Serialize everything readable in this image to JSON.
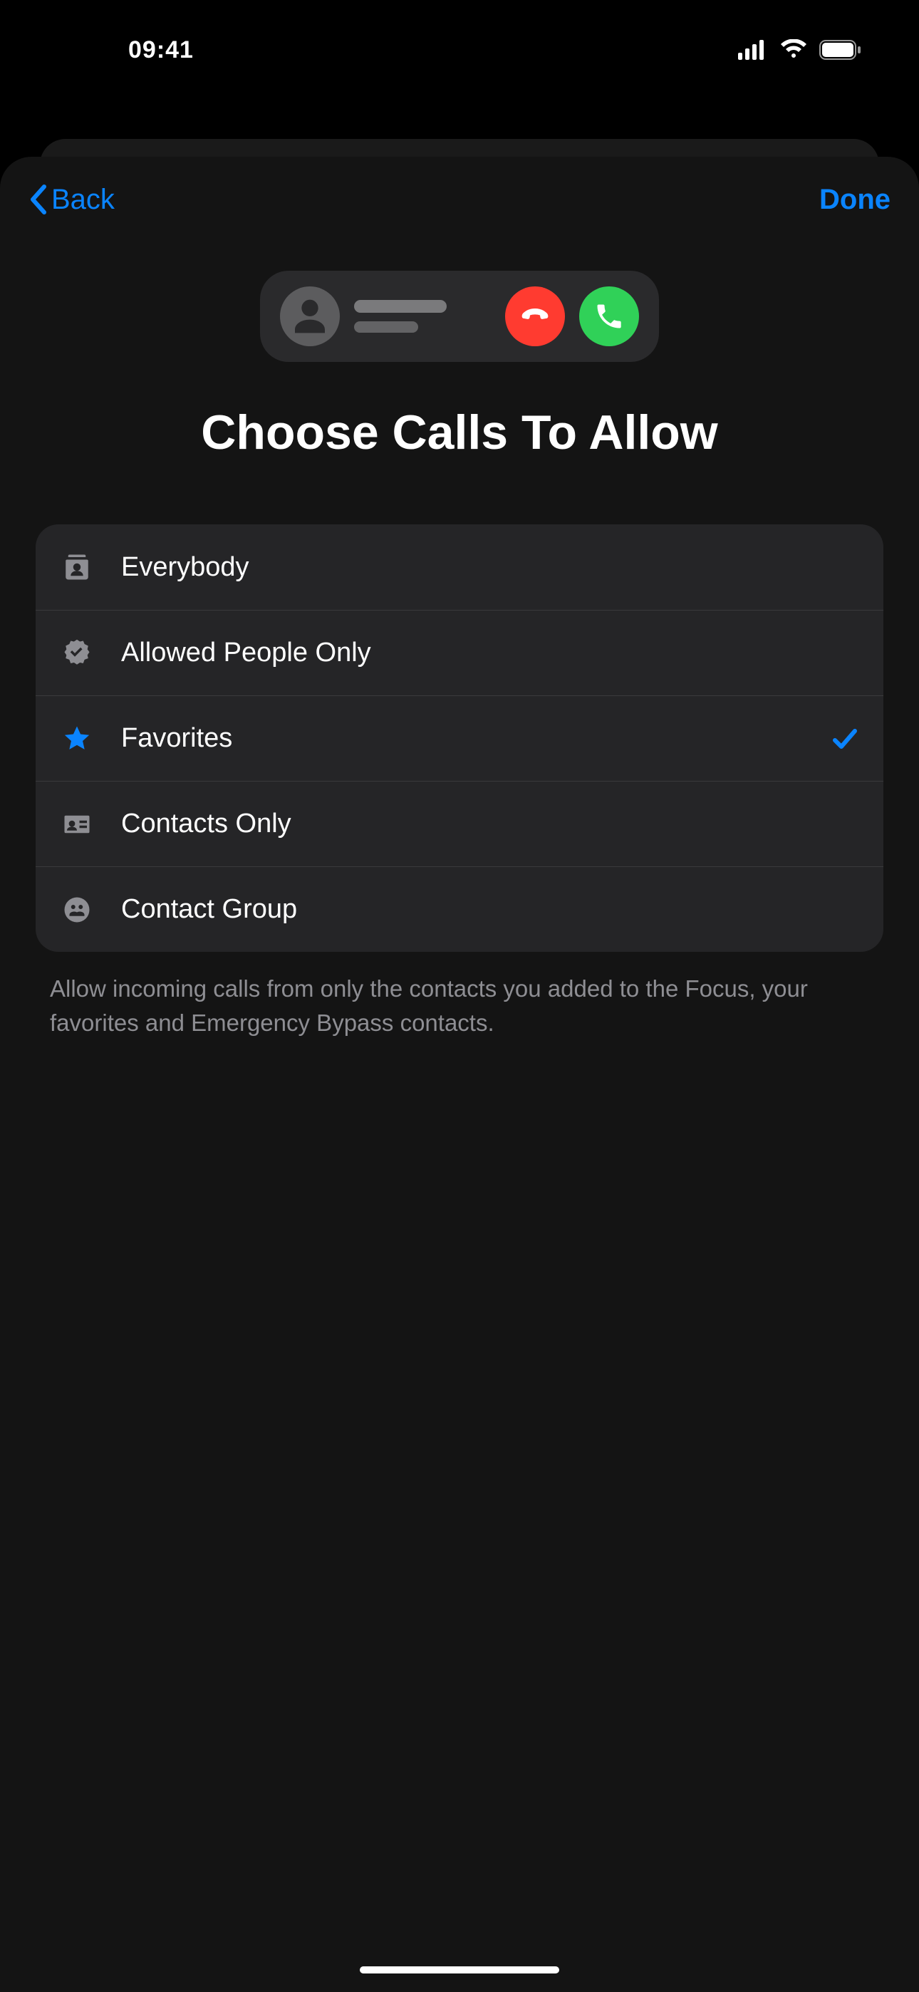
{
  "status_bar": {
    "time": "09:41"
  },
  "nav": {
    "back_label": "Back",
    "done_label": "Done"
  },
  "hero": {
    "title": "Choose Calls To Allow"
  },
  "options": [
    {
      "id": "everybody",
      "label": "Everybody",
      "icon": "contacts-icon",
      "selected": false
    },
    {
      "id": "allowed",
      "label": "Allowed People Only",
      "icon": "seal-check-icon",
      "selected": false
    },
    {
      "id": "favorites",
      "label": "Favorites",
      "icon": "star-icon",
      "selected": true
    },
    {
      "id": "contacts-only",
      "label": "Contacts Only",
      "icon": "id-card-icon",
      "selected": false
    },
    {
      "id": "contact-group",
      "label": "Contact Group",
      "icon": "group-icon",
      "selected": false
    }
  ],
  "footer": "Allow incoming calls from only the contacts you added to the Focus, your favorites and Emergency Bypass contacts.",
  "colors": {
    "accent": "#0a84ff",
    "decline": "#ff3b30",
    "accept": "#30d158"
  }
}
